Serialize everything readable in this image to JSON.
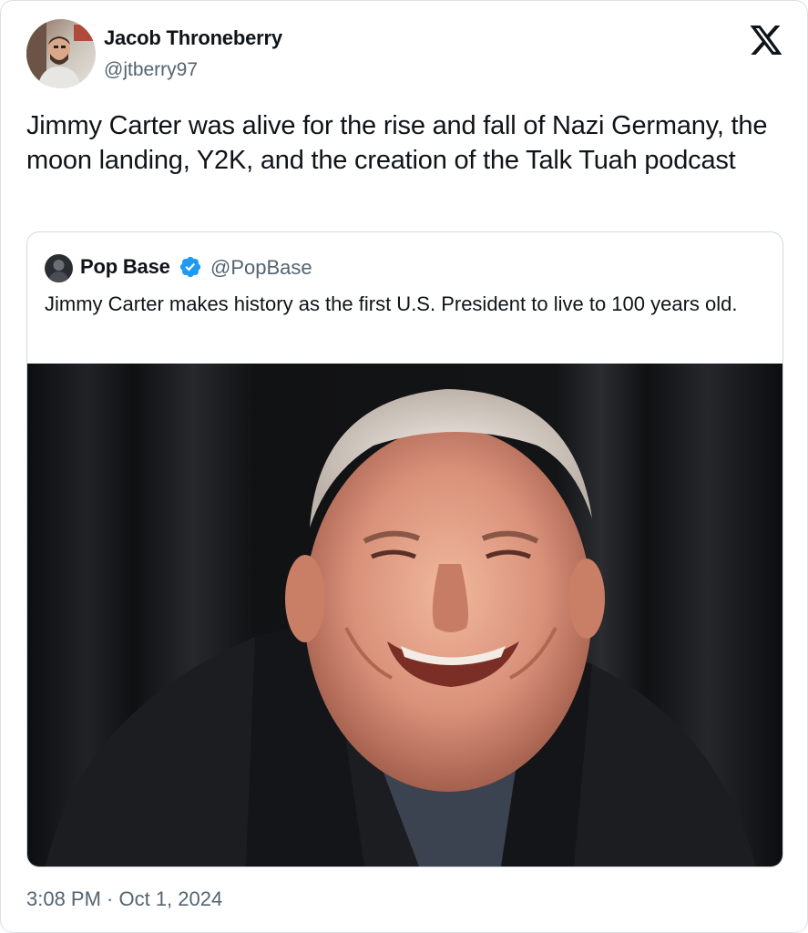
{
  "tweet": {
    "author": {
      "display_name": "Jacob Throneberry",
      "handle": "@jtberry97",
      "avatar_icon": "profile-photo"
    },
    "text": "Jimmy Carter was alive for the rise and fall of Nazi Germany, the moon landing, Y2K, and the creation of the Talk Tuah podcast",
    "timestamp": "3:08 PM · Oct 1, 2024",
    "platform_icon": "x-logo-icon"
  },
  "quoted_tweet": {
    "author": {
      "display_name": "Pop Base",
      "handle": "@PopBase",
      "verified": true,
      "verified_icon": "verified-badge-icon"
    },
    "text": "Jimmy Carter makes history as the first U.S. President to live to 100 years old."
  },
  "colors": {
    "text_primary": "#0f1419",
    "text_secondary": "#536471",
    "verified_blue": "#1d9bf0",
    "border": "#cfd9de"
  }
}
